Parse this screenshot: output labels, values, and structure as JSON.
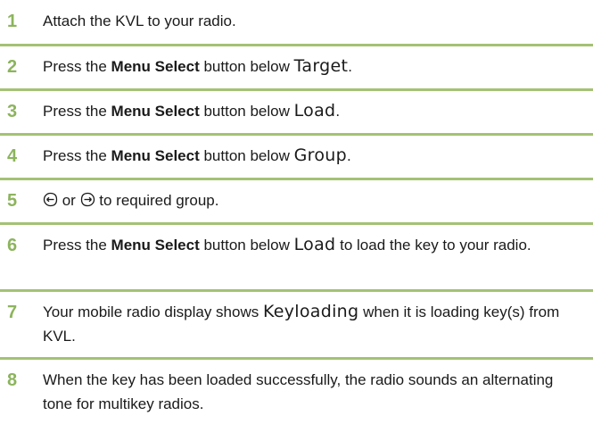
{
  "steps": [
    {
      "number": "1",
      "parts": [
        {
          "t": "Attach the KVL to your radio."
        }
      ]
    },
    {
      "number": "2",
      "parts": [
        {
          "t": "Press the "
        },
        {
          "b": "Menu Select"
        },
        {
          "t": " button below "
        },
        {
          "d": "Target"
        },
        {
          "t": "."
        }
      ]
    },
    {
      "number": "3",
      "parts": [
        {
          "t": "Press the "
        },
        {
          "b": "Menu Select"
        },
        {
          "t": " button below "
        },
        {
          "d": "Load"
        },
        {
          "t": "."
        }
      ]
    },
    {
      "number": "4",
      "parts": [
        {
          "t": "Press the "
        },
        {
          "b": "Menu Select"
        },
        {
          "t": " button below "
        },
        {
          "d": "Group"
        },
        {
          "t": "."
        }
      ]
    },
    {
      "number": "5",
      "parts": [
        {
          "i": "left-nav-icon"
        },
        {
          "t": " or "
        },
        {
          "i": "right-nav-icon"
        },
        {
          "t": " to required group."
        }
      ]
    },
    {
      "number": "6",
      "parts": [
        {
          "t": "Press the "
        },
        {
          "b": "Menu Select"
        },
        {
          "t": " button below "
        },
        {
          "d": "Load"
        },
        {
          "t": " to load the key to your radio."
        }
      ]
    },
    {
      "number": "7",
      "parts": [
        {
          "t": "Your mobile radio display shows "
        },
        {
          "d": "Keyloading"
        },
        {
          "t": " when it is loading key(s) from KVL."
        }
      ]
    },
    {
      "number": "8",
      "parts": [
        {
          "t": "When the key has been loaded successfully, the radio sounds an alternating tone for multikey radios."
        }
      ]
    }
  ],
  "colors": {
    "step_number": "#8cb45c",
    "divider": "#a4c274",
    "text": "#1a1a1a"
  }
}
